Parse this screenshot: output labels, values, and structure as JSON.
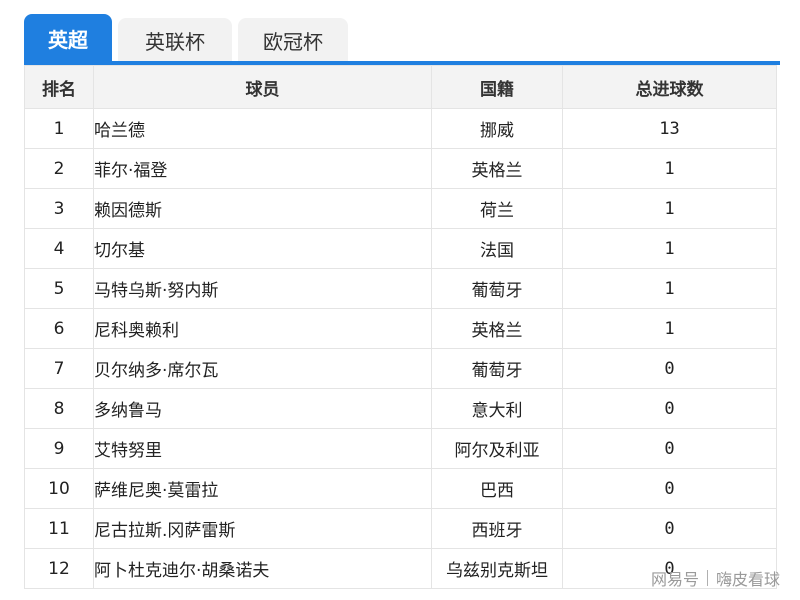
{
  "tabs": [
    {
      "label": "英超",
      "active": true
    },
    {
      "label": "英联杯",
      "active": false
    },
    {
      "label": "欧冠杯",
      "active": false
    }
  ],
  "colors": {
    "accent": "#1f7fe0",
    "header_bg": "#f3f3f3",
    "border": "#e4e4e4"
  },
  "table": {
    "headers": [
      "排名",
      "球员",
      "国籍",
      "总进球数"
    ],
    "rows": [
      {
        "rank": "1",
        "player": "哈兰德",
        "nationality": "挪威",
        "goals": "13"
      },
      {
        "rank": "2",
        "player": "菲尔·福登",
        "nationality": "英格兰",
        "goals": "1"
      },
      {
        "rank": "3",
        "player": "赖因德斯",
        "nationality": "荷兰",
        "goals": "1"
      },
      {
        "rank": "4",
        "player": "切尔基",
        "nationality": "法国",
        "goals": "1"
      },
      {
        "rank": "5",
        "player": "马特乌斯·努内斯",
        "nationality": "葡萄牙",
        "goals": "1"
      },
      {
        "rank": "6",
        "player": "尼科奥赖利",
        "nationality": "英格兰",
        "goals": "1"
      },
      {
        "rank": "7",
        "player": "贝尔纳多·席尔瓦",
        "nationality": "葡萄牙",
        "goals": "0"
      },
      {
        "rank": "8",
        "player": "多纳鲁马",
        "nationality": "意大利",
        "goals": "0"
      },
      {
        "rank": "9",
        "player": "艾特努里",
        "nationality": "阿尔及利亚",
        "goals": "0"
      },
      {
        "rank": "10",
        "player": "萨维尼奥·莫雷拉",
        "nationality": "巴西",
        "goals": "0"
      },
      {
        "rank": "11",
        "player": "尼古拉斯.冈萨雷斯",
        "nationality": "西班牙",
        "goals": "0"
      },
      {
        "rank": "12",
        "player": "阿卜杜克迪尔·胡桑诺夫",
        "nationality": "乌兹别克斯坦",
        "goals": "0"
      }
    ]
  },
  "watermark": {
    "source": "网易号",
    "author": "嗨皮看球"
  }
}
